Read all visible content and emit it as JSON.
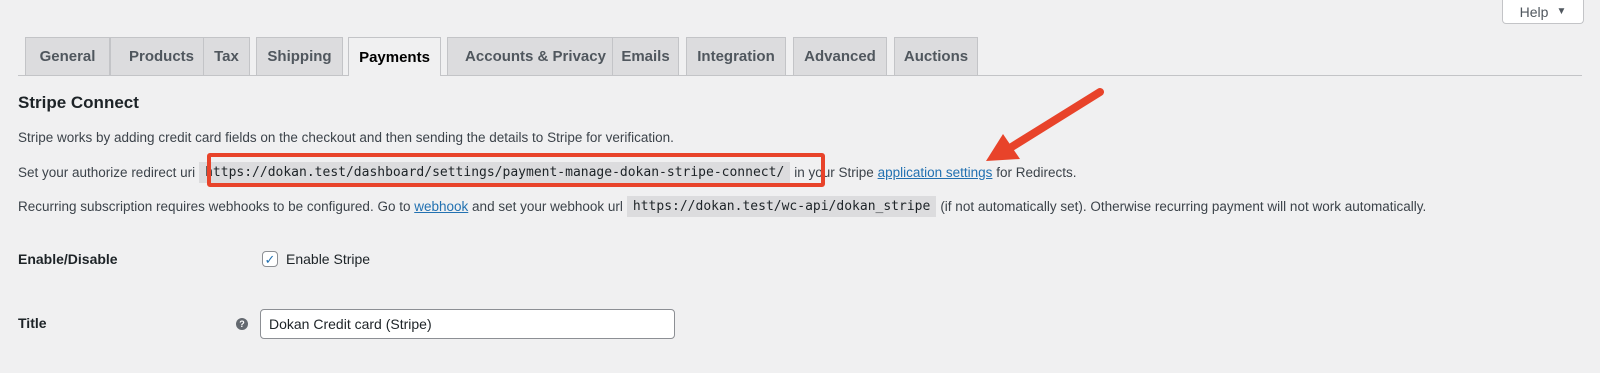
{
  "help": {
    "label": "Help",
    "caret": "▼"
  },
  "tabs": [
    {
      "label": "General"
    },
    {
      "label": "Products"
    },
    {
      "label": "Tax"
    },
    {
      "label": "Shipping"
    },
    {
      "label": "Payments",
      "active": true
    },
    {
      "label": "Accounts & Privacy"
    },
    {
      "label": "Emails"
    },
    {
      "label": "Integration"
    },
    {
      "label": "Advanced"
    },
    {
      "label": "Auctions"
    }
  ],
  "section": {
    "title": "Stripe Connect",
    "intro": "Stripe works by adding credit card fields on the checkout and then sending the details to Stripe for verification.",
    "redirect_prefix": "Set your authorize redirect uri",
    "redirect_uri": "https://dokan.test/dashboard/settings/payment-manage-dokan-stripe-connect/",
    "redirect_mid": "in your Stripe",
    "redirect_link": "application settings",
    "redirect_suffix": "for Redirects.",
    "webhook_prefix": "Recurring subscription requires webhooks to be configured. Go to",
    "webhook_link": "webhook",
    "webhook_mid": "and set your webhook url",
    "webhook_url": "https://dokan.test/wc-api/dokan_stripe",
    "webhook_suffix": "(if not automatically set). Otherwise recurring payment will not work automatically."
  },
  "fields": {
    "enable_label": "Enable/Disable",
    "enable_checkbox_label": "Enable Stripe",
    "enable_checked": true,
    "title_label": "Title",
    "title_value": "Dokan Credit card (Stripe)",
    "tip_glyph": "?"
  },
  "colors": {
    "annotation": "#e8432a",
    "link": "#2271b1",
    "background": "#f0f0f1"
  }
}
